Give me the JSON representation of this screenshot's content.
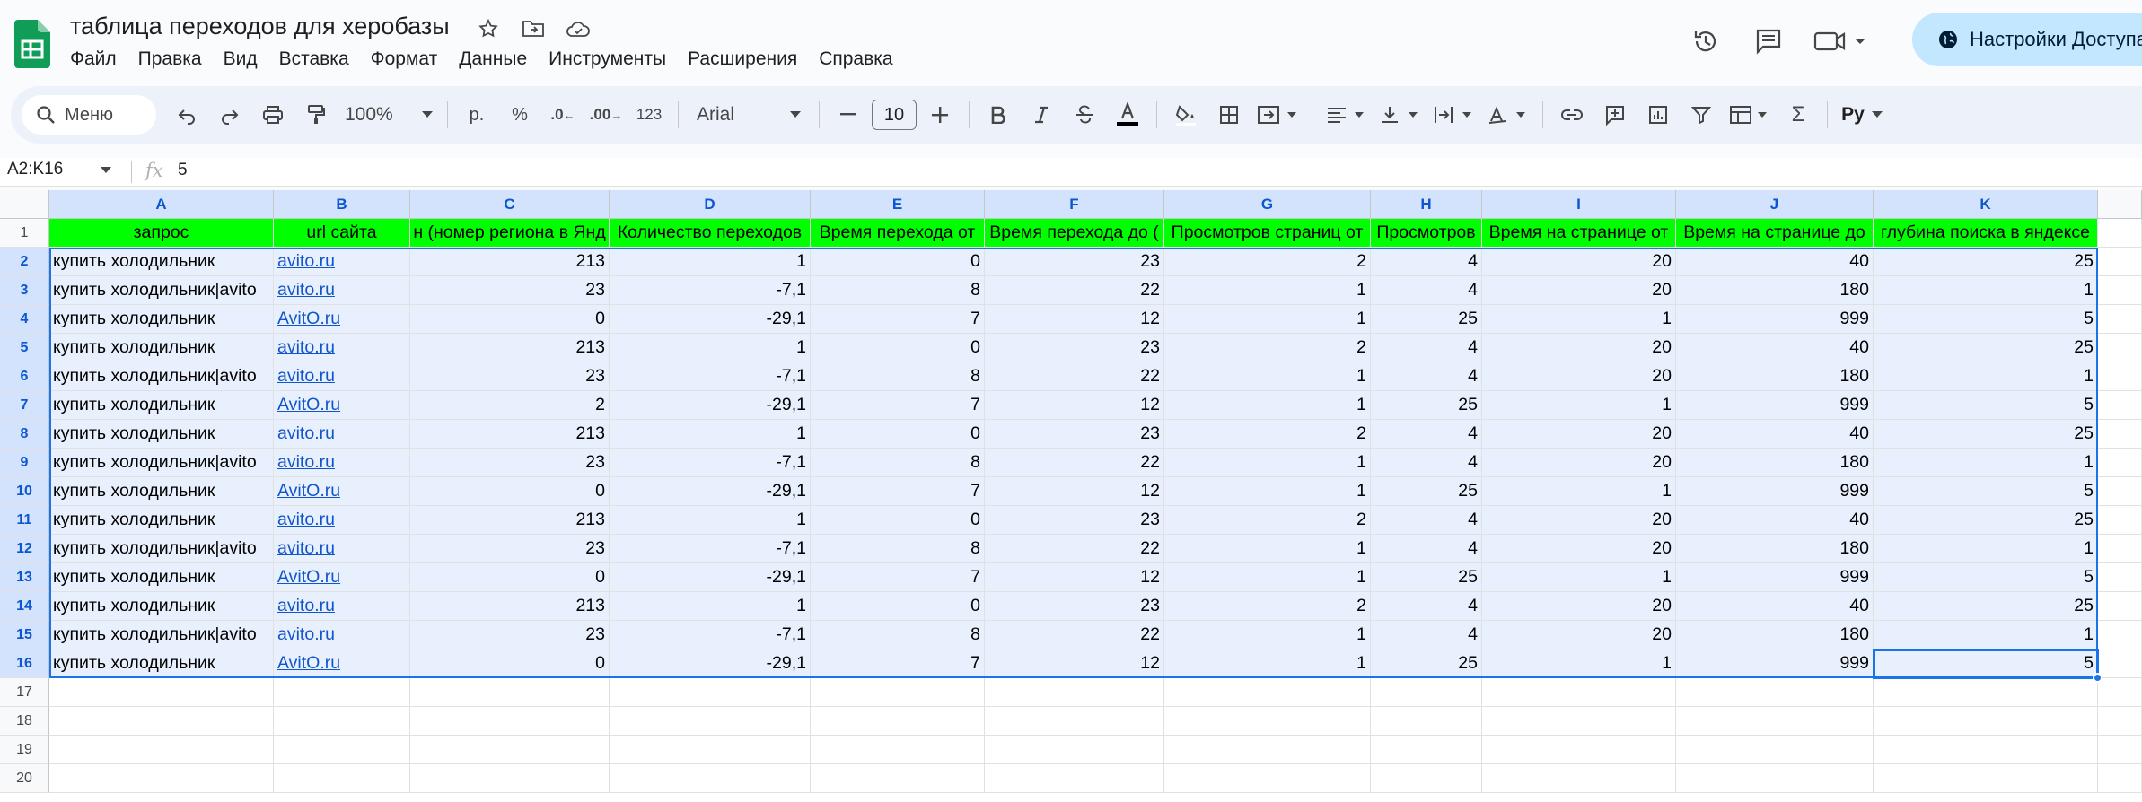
{
  "doc": {
    "title": "таблица переходов для херобазы"
  },
  "menu": [
    "Файл",
    "Правка",
    "Вид",
    "Вставка",
    "Формат",
    "Данные",
    "Инструменты",
    "Расширения",
    "Справка"
  ],
  "share": {
    "label": "Настройки Доступа"
  },
  "toolbar": {
    "search_label": "Меню",
    "zoom": "100%",
    "currency": "р.",
    "percent": "%",
    "dec_less": ".0",
    "dec_more": ".00",
    "num_format": "123",
    "font": "Arial",
    "font_size": "10",
    "input_tools": "Pу"
  },
  "formula_bar": {
    "name_box": "A2:K16",
    "fx": "fx",
    "value": "5"
  },
  "colors": {
    "header_fill": "#00ff00",
    "selection": "#1a73e8",
    "link": "#1155cc",
    "share_bg": "#c2e7ff"
  },
  "sheet": {
    "columns": [
      "A",
      "B",
      "C",
      "D",
      "E",
      "F",
      "G",
      "H",
      "I",
      "J",
      "K"
    ],
    "row_numbers": [
      "1",
      "2",
      "3",
      "4",
      "5",
      "6",
      "7",
      "8",
      "9",
      "10",
      "11",
      "12",
      "13",
      "14",
      "15",
      "16",
      "17",
      "18",
      "19",
      "20"
    ],
    "header": [
      "запрос",
      "url сайта",
      "н (номер региона в Янд",
      "Количество переходов",
      "Время  перехода от",
      "Время перехода до (",
      "Просмотров страниц от",
      "Просмотров",
      "Время на странице от",
      "Время на странице до",
      "глубина поиска в яндексе"
    ],
    "rows": [
      [
        "купить холодильник",
        "avito.ru",
        "213",
        "1",
        "0",
        "23",
        "2",
        "4",
        "20",
        "40",
        "25"
      ],
      [
        "купить холодильник|avito",
        "avito.ru",
        "23",
        "-7,1",
        "8",
        "22",
        "1",
        "4",
        "20",
        "180",
        "1"
      ],
      [
        "купить холодильник",
        "AvitO.ru",
        "0",
        "-29,1",
        "7",
        "12",
        "1",
        "25",
        "1",
        "999",
        "5"
      ],
      [
        "купить холодильник",
        "avito.ru",
        "213",
        "1",
        "0",
        "23",
        "2",
        "4",
        "20",
        "40",
        "25"
      ],
      [
        "купить холодильник|avito",
        "avito.ru",
        "23",
        "-7,1",
        "8",
        "22",
        "1",
        "4",
        "20",
        "180",
        "1"
      ],
      [
        "купить холодильник",
        "AvitO.ru",
        "2",
        "-29,1",
        "7",
        "12",
        "1",
        "25",
        "1",
        "999",
        "5"
      ],
      [
        "купить холодильник",
        "avito.ru",
        "213",
        "1",
        "0",
        "23",
        "2",
        "4",
        "20",
        "40",
        "25"
      ],
      [
        "купить холодильник|avito",
        "avito.ru",
        "23",
        "-7,1",
        "8",
        "22",
        "1",
        "4",
        "20",
        "180",
        "1"
      ],
      [
        "купить холодильник",
        "AvitO.ru",
        "0",
        "-29,1",
        "7",
        "12",
        "1",
        "25",
        "1",
        "999",
        "5"
      ],
      [
        "купить холодильник",
        "avito.ru",
        "213",
        "1",
        "0",
        "23",
        "2",
        "4",
        "20",
        "40",
        "25"
      ],
      [
        "купить холодильник|avito",
        "avito.ru",
        "23",
        "-7,1",
        "8",
        "22",
        "1",
        "4",
        "20",
        "180",
        "1"
      ],
      [
        "купить холодильник",
        "AvitO.ru",
        "0",
        "-29,1",
        "7",
        "12",
        "1",
        "25",
        "1",
        "999",
        "5"
      ],
      [
        "купить холодильник",
        "avito.ru",
        "213",
        "1",
        "0",
        "23",
        "2",
        "4",
        "20",
        "40",
        "25"
      ],
      [
        "купить холодильник|avito",
        "avito.ru",
        "23",
        "-7,1",
        "8",
        "22",
        "1",
        "4",
        "20",
        "180",
        "1"
      ],
      [
        "купить холодильник",
        "AvitO.ru",
        "0",
        "-29,1",
        "7",
        "12",
        "1",
        "25",
        "1",
        "999",
        "5"
      ]
    ]
  }
}
